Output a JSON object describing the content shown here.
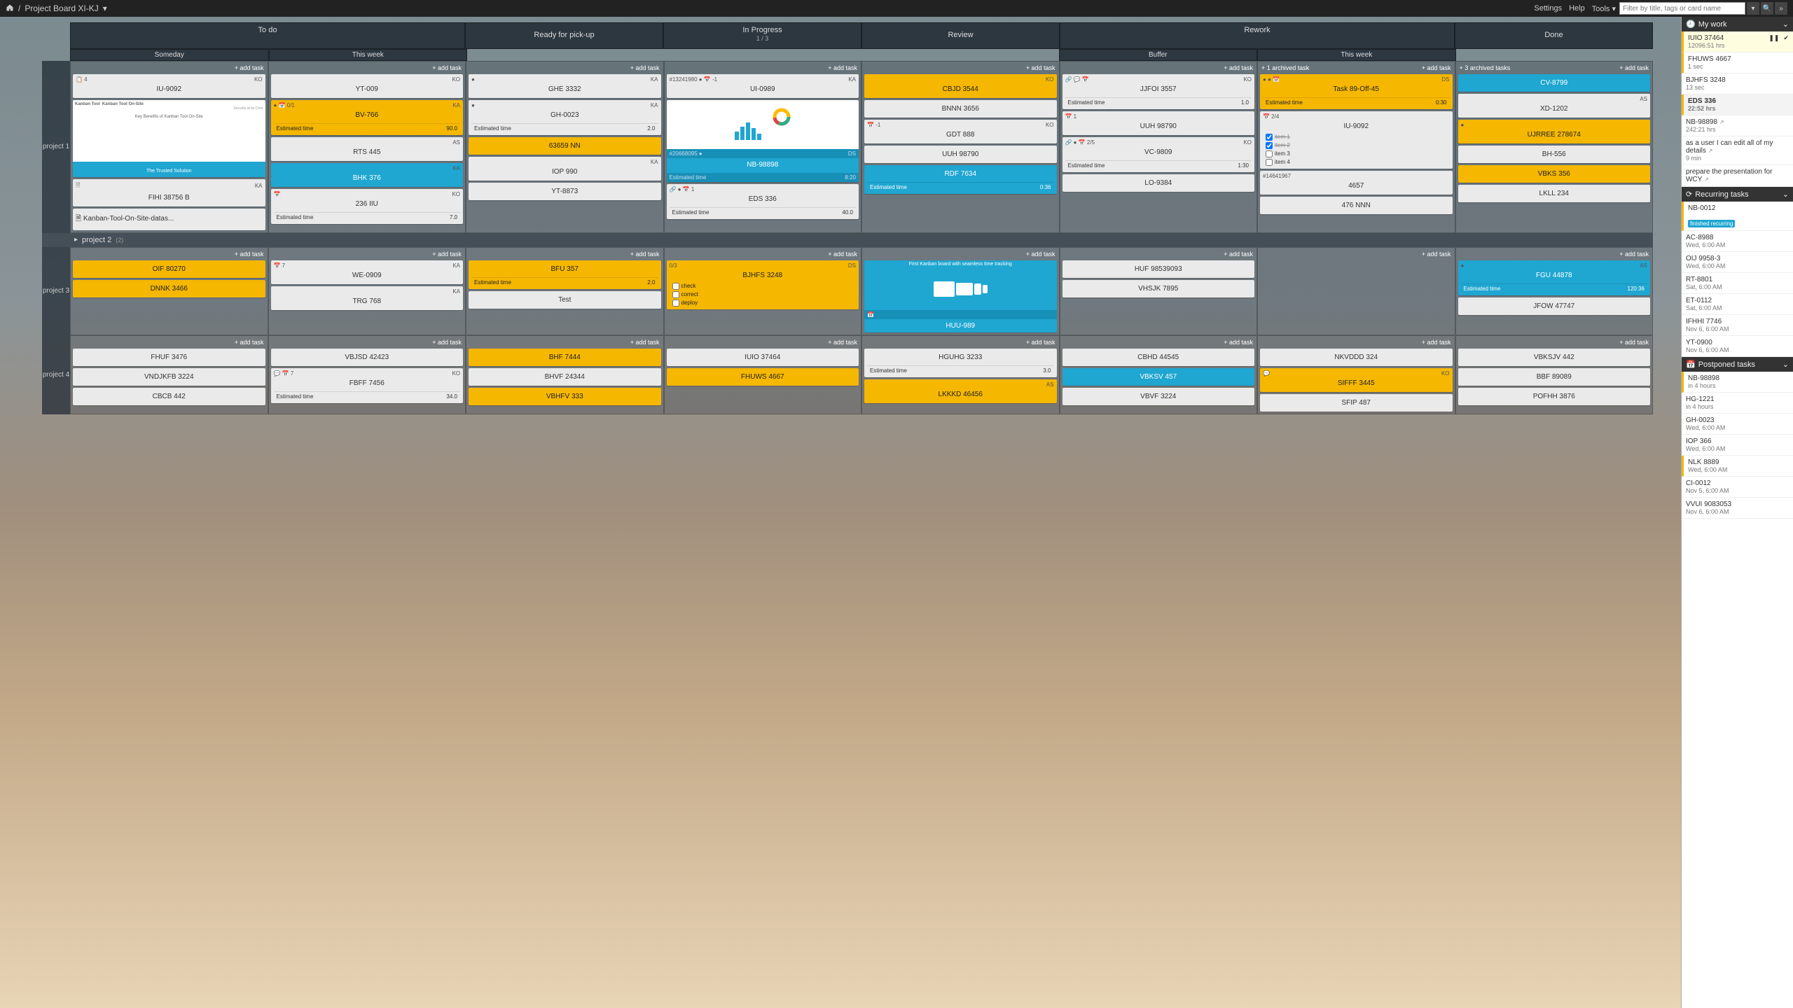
{
  "breadcrumb": {
    "home": "⌂",
    "title": "Project Board XI-KJ"
  },
  "topnav": {
    "settings": "Settings",
    "help": "Help",
    "tools": "Tools",
    "filter_placeholder": "Filter by title, tags or card name"
  },
  "columns_top": [
    {
      "label": "To do",
      "span": 2
    },
    {
      "label": "Ready for pick-up",
      "span": 1,
      "rowspan": 2
    },
    {
      "label": "In Progress",
      "sub": "1 / 3",
      "span": 1,
      "rowspan": 2
    },
    {
      "label": "Review",
      "span": 1,
      "rowspan": 2
    },
    {
      "label": "Rework",
      "span": 2
    },
    {
      "label": "Done",
      "span": 1,
      "rowspan": 2
    }
  ],
  "columns_sub_left": [
    {
      "label": "Someday"
    },
    {
      "label": "This week"
    }
  ],
  "columns_sub_right": [
    {
      "label": "Buffer"
    },
    {
      "label": "This week"
    }
  ],
  "add_task": "+ add task",
  "archived_1": "+ 1 archived task",
  "archived_3": "+ 3 archived tasks",
  "swimlanes": [
    {
      "name": "project 1"
    },
    {
      "name": "project 2",
      "count": "(2)"
    },
    {
      "name": "project 3"
    },
    {
      "name": "project 4"
    }
  ],
  "p1": {
    "someday": [
      {
        "t": "IU-9092",
        "meta_l": "📋 4",
        "meta_r": "KO"
      },
      {
        "type": "thumb",
        "banner": "The Trusted Solution",
        "h1": "Kanban Tool",
        "h2": "Kanban Tool On-Site",
        "sub": "Security at its Core",
        "body": "Key Benefits of Kanban Tool On-Site"
      },
      {
        "t": "FIHI 38756 B",
        "meta_l": "🗎",
        "meta_r": "KA"
      },
      {
        "t": "Kanban-Tool-On-Site-datas...",
        "attach": true
      }
    ],
    "thisweek_l": [
      {
        "t": "YT-009",
        "meta_r": "KO"
      },
      {
        "t": "BV-766",
        "c": "y",
        "meta_l": "● 📅 0/1",
        "meta_r": "KA",
        "est": "Estimated time",
        "est_v": "90.0"
      },
      {
        "t": "RTS 445",
        "meta_r": "AS"
      },
      {
        "t": "BHK 376",
        "c": "b",
        "meta_r": "KA"
      },
      {
        "t": "236 IIU",
        "meta_l": "📅",
        "meta_r": "KO",
        "est": "Estimated time",
        "est_v": "7.0"
      }
    ],
    "ready": [
      {
        "t": "GHE 3332",
        "meta_l": "●",
        "meta_r": "KA"
      },
      {
        "t": "GH-0023",
        "meta_l": "●",
        "meta_r": "KA",
        "est": "Estimated time",
        "est_v": "2.0"
      },
      {
        "t": "63659 NN",
        "c": "y"
      },
      {
        "t": "IOP 990",
        "meta_r": "KA"
      },
      {
        "t": "YT-8873"
      }
    ],
    "inprog": [
      {
        "t": "UI-0989",
        "meta_l": "#13241980 ● 📅 -1",
        "meta_r": "KA"
      },
      {
        "type": "chart",
        "id": "#20668095",
        "t": "NB-98898",
        "meta_r": "DS",
        "est": "Estimated time",
        "est_v": "8:20"
      },
      {
        "t": "EDS 336",
        "meta_l": "🔗 ● 📅 1",
        "est": "Estimated time",
        "est_v": "40.0"
      }
    ],
    "review": [
      {
        "t": "CBJD 3544",
        "c": "y",
        "meta_r": "KO"
      },
      {
        "t": "BNNN 3656"
      },
      {
        "t": "GDT 888",
        "meta_l": "📅 -1",
        "meta_r": "KO"
      },
      {
        "t": "UUH 98790"
      },
      {
        "t": "RDF 7634",
        "c": "b",
        "est": "Estimated time",
        "est_v": "0:36"
      }
    ],
    "buffer": [
      {
        "t": "JJFOI 3557",
        "meta_l": "🔗 💬 📅",
        "meta_r": "KO",
        "est": "Estimated time",
        "est_v": "1.0"
      },
      {
        "t": "UUH 98790",
        "meta_l": "📅 1"
      },
      {
        "t": "VC-9809",
        "meta_l": "🔗 ● 📅 2/5",
        "meta_r": "KO",
        "est": "Estimated time",
        "est_v": "1:30"
      },
      {
        "t": "LO-9384"
      }
    ],
    "thisweek_r": [
      {
        "t": "Task 89-Off-45",
        "c": "y",
        "meta_l": "● ● 📅",
        "meta_r": "DS",
        "est": "Estimated time",
        "est_v": "0:30"
      },
      {
        "t": "IU-9092",
        "meta_l": "📅 2/4",
        "checks": [
          {
            "l": "item 1",
            "d": true
          },
          {
            "l": "item 2",
            "d": true
          },
          {
            "l": "item 3"
          },
          {
            "l": "item 4"
          }
        ]
      },
      {
        "t": "4657",
        "meta_l": "#14641967"
      },
      {
        "t": "476 NNN"
      }
    ],
    "done": [
      {
        "t": "CV-8799",
        "c": "b"
      },
      {
        "t": "XD-1202",
        "meta_r": "AS"
      },
      {
        "t": "UJRREE 278674",
        "c": "y",
        "meta_l": "●"
      },
      {
        "t": "BH-556"
      },
      {
        "t": "VBKS 356",
        "c": "y"
      },
      {
        "t": "LKLL 234"
      }
    ]
  },
  "p3": {
    "someday": [
      {
        "t": "OIF 80270",
        "c": "y"
      },
      {
        "t": "DNNK 3466",
        "c": "y"
      }
    ],
    "thisweek_l": [
      {
        "t": "WE-0909",
        "meta_l": "📅 7",
        "meta_r": "KA"
      },
      {
        "t": "TRG 768",
        "meta_r": "KA"
      }
    ],
    "ready": [
      {
        "t": "BFU 357",
        "c": "y",
        "est": "Estimated time",
        "est_v": "2.0"
      },
      {
        "t": "Test"
      }
    ],
    "inprog": [
      {
        "t": "BJHFS 3248",
        "meta_l": "0/3",
        "meta_r": "DS",
        "c": "y",
        "checks": [
          {
            "l": "check"
          },
          {
            "l": "correct"
          },
          {
            "l": "deploy"
          }
        ]
      }
    ],
    "review": [
      {
        "type": "devices",
        "t": "HUU-989",
        "meta_l": "📅",
        "c": "b",
        "banner": "First Kanban board with seamless time tracking"
      }
    ],
    "buffer": [
      {
        "t": "HUF 98539093"
      },
      {
        "t": "VHSJK 7895"
      }
    ],
    "thisweek_r": [],
    "done": [
      {
        "t": "FGU 44878",
        "c": "b",
        "meta_l": "●",
        "meta_r": "AS",
        "est": "Estimated time",
        "est_v": "120:36"
      },
      {
        "t": "JFOW 47747"
      }
    ]
  },
  "p4": {
    "someday": [
      {
        "t": "FHUF 3476"
      },
      {
        "t": "VNDJKFB 3224"
      },
      {
        "t": "CBCB 442"
      }
    ],
    "thisweek_l": [
      {
        "t": "VBJSD 42423"
      },
      {
        "t": "FBFF 7456",
        "meta_l": "💬 📅 7",
        "meta_r": "KO",
        "est": "Estimated time",
        "est_v": "34.0"
      }
    ],
    "ready": [
      {
        "t": "BHF 7444",
        "c": "y"
      },
      {
        "t": "BHVF 24344"
      },
      {
        "t": "VBHFV 333",
        "c": "y"
      }
    ],
    "inprog": [
      {
        "t": "IUIO 37464"
      },
      {
        "t": "FHUWS 4667",
        "c": "y"
      }
    ],
    "review": [
      {
        "t": "HGUHG 3233",
        "est": "Estimated time",
        "est_v": "3.0"
      },
      {
        "t": "LKKKD 46456",
        "c": "y",
        "meta_r": "AS"
      }
    ],
    "buffer": [
      {
        "t": "CBHD 44545"
      },
      {
        "t": "VBKSV 457",
        "c": "b"
      },
      {
        "t": "VBVF 3224"
      }
    ],
    "thisweek_r": [
      {
        "t": "NKVDDD 324"
      },
      {
        "t": "SIFFF 3445",
        "c": "y",
        "meta_l": "💬",
        "meta_r": "KO"
      },
      {
        "t": "SFIP 487"
      }
    ],
    "done": [
      {
        "t": "VBKSJV 442"
      },
      {
        "t": "BBF 89089"
      },
      {
        "t": "POFHH 3876"
      }
    ]
  },
  "side": {
    "mywork": {
      "title": "My work",
      "items": [
        {
          "t": "IUIO 37464",
          "sub": "12096:51 hrs",
          "hl": true,
          "ctrl": true
        },
        {
          "t": "FHUWS 4667",
          "sub": "1 sec",
          "bl": true
        },
        {
          "t": "BJHFS 3248",
          "sub": "13 sec"
        },
        {
          "t": "EDS 336",
          "sub": "22:52 hrs",
          "sel": true
        },
        {
          "t": "NB-98898",
          "sub": "242:21 hrs",
          "ext": true
        },
        {
          "t": "as a user I can edit all of my details",
          "sub": "9 min",
          "ext": true
        },
        {
          "t": "prepare the presentation for WCY",
          "sub": "",
          "ext": true
        }
      ]
    },
    "recurring": {
      "title": "Recurring tasks",
      "items": [
        {
          "t": "NB-0012",
          "tag": "finished recurring",
          "bl": true
        },
        {
          "t": "AC-8988",
          "sub": "Wed, 6:00 AM"
        },
        {
          "t": "OIJ 9958-3",
          "sub": "Wed, 6:00 AM"
        },
        {
          "t": "RT-8801",
          "sub": "Sat, 6:00 AM"
        },
        {
          "t": "ET-0112",
          "sub": "Sat, 6:00 AM"
        },
        {
          "t": "IFHHI 7746",
          "sub": "Nov 6, 6:00 AM"
        },
        {
          "t": "YT-0900",
          "sub": "Nov 6, 6:00 AM"
        }
      ]
    },
    "postponed": {
      "title": "Postponed tasks",
      "items": [
        {
          "t": "NB-98898",
          "sub": "in 4 hours",
          "bl": true
        },
        {
          "t": "HG-1221",
          "sub": "in 4 hours"
        },
        {
          "t": "GH-0023",
          "sub": "Wed, 6:00 AM"
        },
        {
          "t": "IOP 366",
          "sub": "Wed, 6:00 AM"
        },
        {
          "t": "NLK 8889",
          "sub": "Wed, 6:00 AM",
          "bl": true
        },
        {
          "t": "CI-0012",
          "sub": "Nov 5, 6:00 AM"
        },
        {
          "t": "VVUI 9083053",
          "sub": "Nov 6, 6:00 AM"
        }
      ]
    }
  }
}
